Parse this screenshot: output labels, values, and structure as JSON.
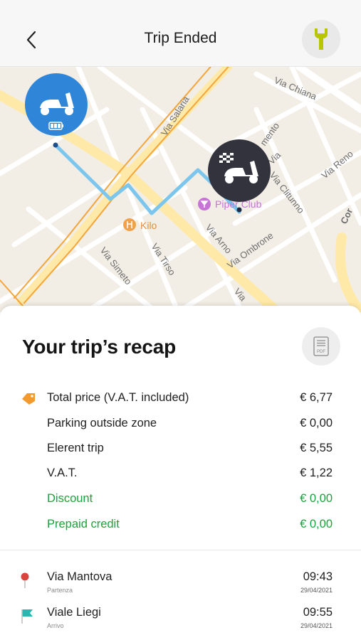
{
  "header": {
    "title": "Trip Ended"
  },
  "icons": {
    "back": "chevron-left-icon",
    "service": "wrench-icon",
    "pdf": "pdf-document-icon",
    "price": "price-tag-icon",
    "start": "start-pin-icon",
    "end": "finish-flag-icon",
    "scooter": "scooter-icon",
    "battery": "battery-icon",
    "finish": "checkered-flag-icon"
  },
  "colors": {
    "accent_yellow": "#b7c600",
    "scooter_blue": "#2f86d9",
    "finish_dark": "#33333d",
    "route": "#7cc6ee",
    "green": "#1aa33c",
    "start_red": "#d9453c",
    "end_teal": "#2ab7b0"
  },
  "map": {
    "streets": [
      "Via Chiana",
      "Via Salaria",
      "Via Clitunno",
      "Via Reno",
      "Via Arno",
      "Via Ombrone",
      "Via Simeto",
      "Via Tirso",
      "Via",
      "mento",
      "Via",
      "Cor"
    ],
    "pois": [
      {
        "name": "Piper Club"
      },
      {
        "name": "Kilo"
      }
    ]
  },
  "recap": {
    "title": "Your trip’s recap",
    "rows": [
      {
        "label": "Total price (V.A.T. included)",
        "value": "€ 6,77"
      },
      {
        "label": "Parking outside zone",
        "value": "€ 0,00"
      },
      {
        "label": "Elerent trip",
        "value": "€ 5,55"
      },
      {
        "label": "V.A.T.",
        "value": "€ 1,22"
      },
      {
        "label": "Discount",
        "value": "€ 0,00"
      },
      {
        "label": "Prepaid credit",
        "value": "€ 0,00"
      }
    ]
  },
  "stops": [
    {
      "name": "Via Mantova",
      "sub": "Partenza",
      "time": "09:43",
      "date": "29/04/2021"
    },
    {
      "name": "Viale Liegi",
      "sub": "Arrivo",
      "time": "09:55",
      "date": "29/04/2021"
    }
  ]
}
